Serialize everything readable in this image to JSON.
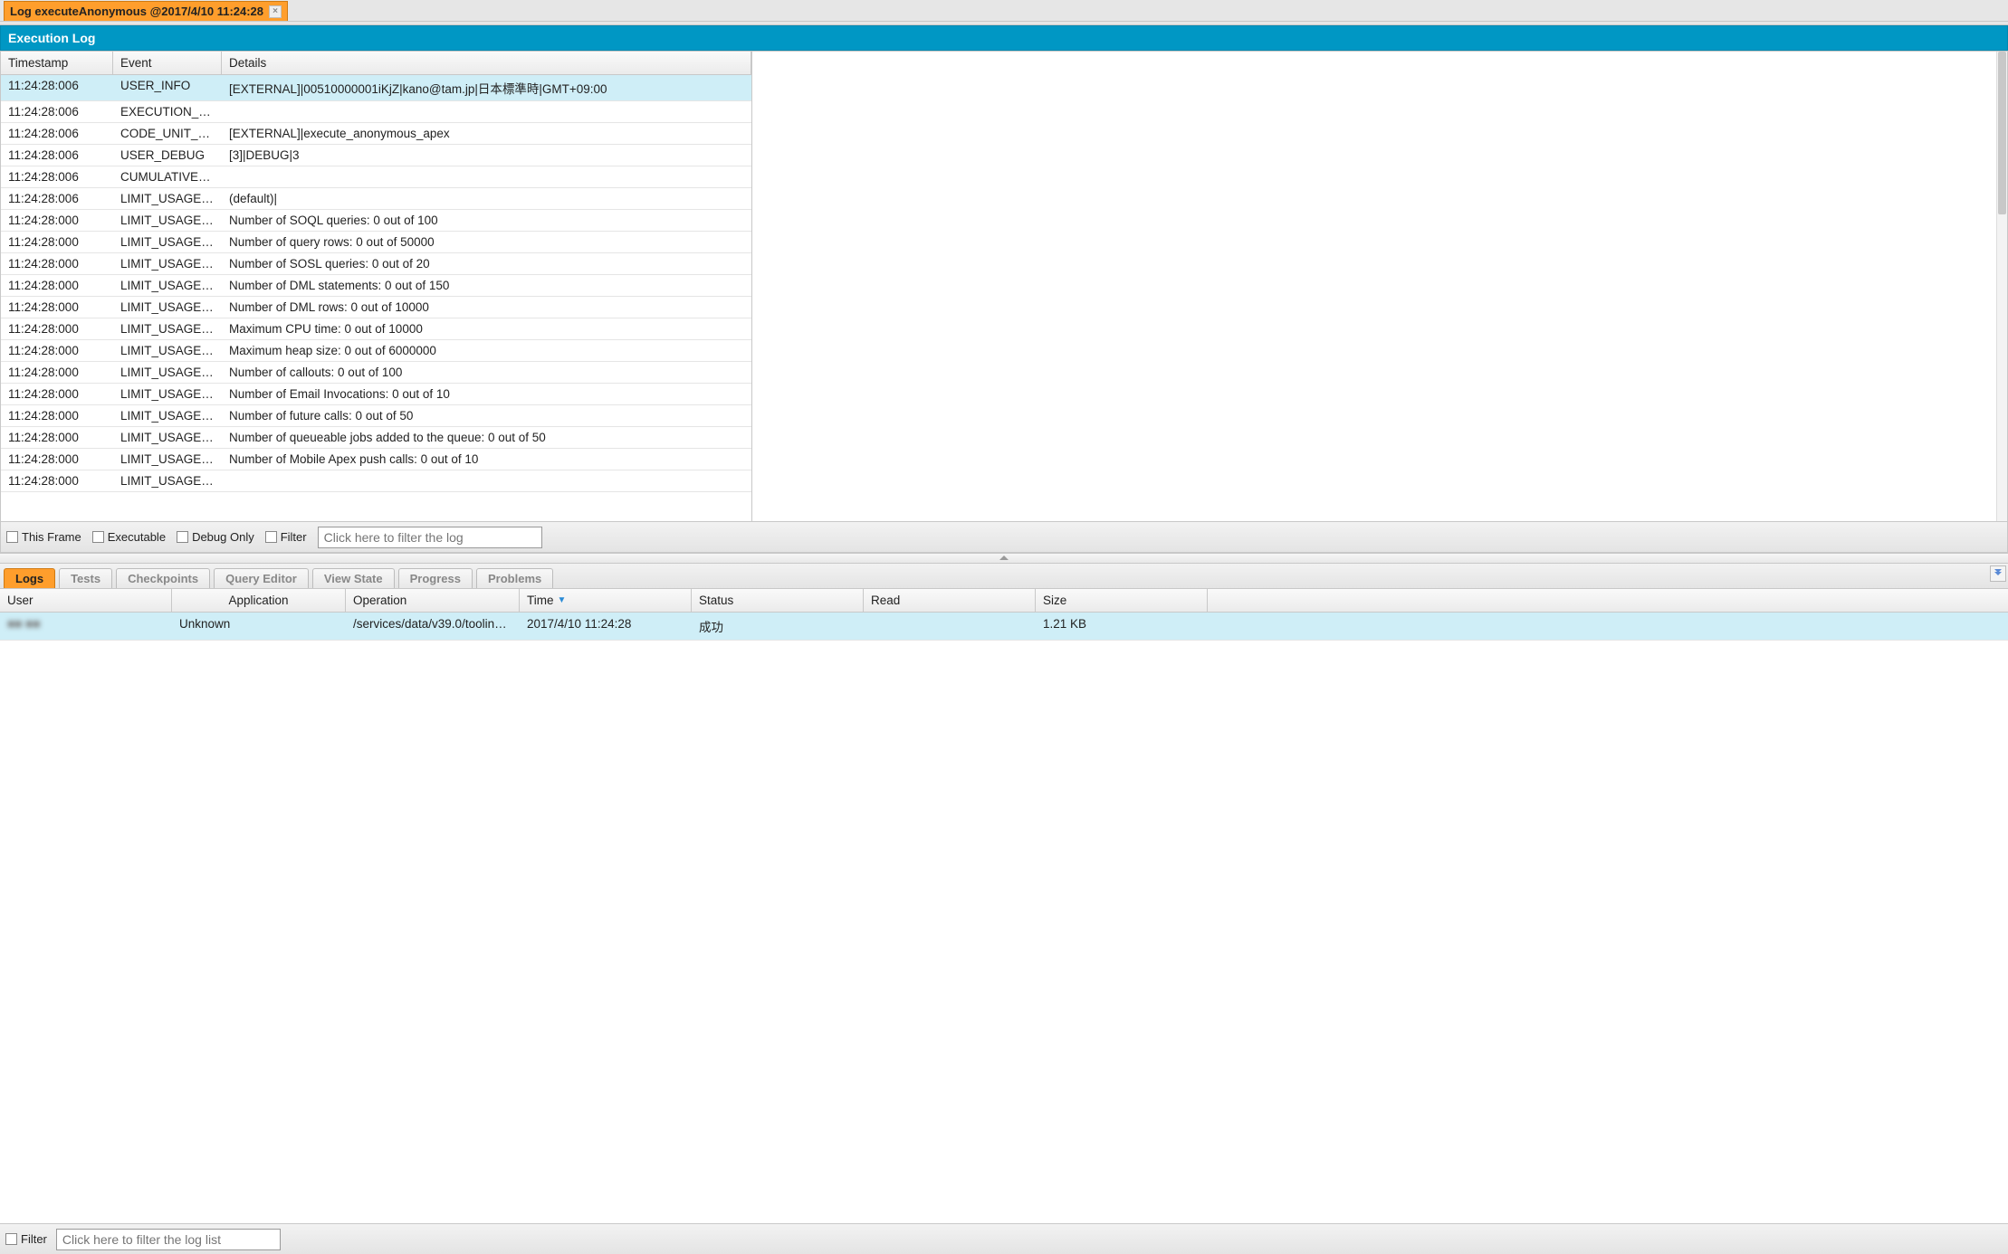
{
  "top_tab": {
    "label": "Log executeAnonymous @2017/4/10 11:24:28"
  },
  "section_title": "Execution Log",
  "log_columns": {
    "timestamp": "Timestamp",
    "event": "Event",
    "details": "Details"
  },
  "log_rows": [
    {
      "ts": "11:24:28:006",
      "ev": "USER_INFO",
      "de": "[EXTERNAL]|00510000001iKjZ|kano@tam.jp|日本標準時|GMT+09:00",
      "sel": true
    },
    {
      "ts": "11:24:28:006",
      "ev": "EXECUTION_S…",
      "de": ""
    },
    {
      "ts": "11:24:28:006",
      "ev": "CODE_UNIT_S…",
      "de": "[EXTERNAL]|execute_anonymous_apex"
    },
    {
      "ts": "11:24:28:006",
      "ev": "USER_DEBUG",
      "de": "[3]|DEBUG|3"
    },
    {
      "ts": "11:24:28:006",
      "ev": "CUMULATIVE_…",
      "de": ""
    },
    {
      "ts": "11:24:28:006",
      "ev": "LIMIT_USAGE_…",
      "de": "(default)|"
    },
    {
      "ts": "11:24:28:000",
      "ev": "LIMIT_USAGE_…",
      "de": "Number of SOQL queries: 0 out of 100"
    },
    {
      "ts": "11:24:28:000",
      "ev": "LIMIT_USAGE_…",
      "de": "Number of query rows: 0 out of 50000"
    },
    {
      "ts": "11:24:28:000",
      "ev": "LIMIT_USAGE_…",
      "de": "Number of SOSL queries: 0 out of 20"
    },
    {
      "ts": "11:24:28:000",
      "ev": "LIMIT_USAGE_…",
      "de": "Number of DML statements: 0 out of 150"
    },
    {
      "ts": "11:24:28:000",
      "ev": "LIMIT_USAGE_…",
      "de": "Number of DML rows: 0 out of 10000"
    },
    {
      "ts": "11:24:28:000",
      "ev": "LIMIT_USAGE_…",
      "de": "Maximum CPU time: 0 out of 10000"
    },
    {
      "ts": "11:24:28:000",
      "ev": "LIMIT_USAGE_…",
      "de": "Maximum heap size: 0 out of 6000000"
    },
    {
      "ts": "11:24:28:000",
      "ev": "LIMIT_USAGE_…",
      "de": "Number of callouts: 0 out of 100"
    },
    {
      "ts": "11:24:28:000",
      "ev": "LIMIT_USAGE_…",
      "de": "Number of Email Invocations: 0 out of 10"
    },
    {
      "ts": "11:24:28:000",
      "ev": "LIMIT_USAGE_…",
      "de": "Number of future calls: 0 out of 50"
    },
    {
      "ts": "11:24:28:000",
      "ev": "LIMIT_USAGE_…",
      "de": "Number of queueable jobs added to the queue: 0 out of 50"
    },
    {
      "ts": "11:24:28:000",
      "ev": "LIMIT_USAGE_…",
      "de": "Number of Mobile Apex push calls: 0 out of 10"
    },
    {
      "ts": "11:24:28:000",
      "ev": "LIMIT_USAGE_…",
      "de": ""
    }
  ],
  "log_filter": {
    "this_frame": "This Frame",
    "executable": "Executable",
    "debug_only": "Debug Only",
    "filter": "Filter",
    "placeholder": "Click here to filter the log"
  },
  "bottom_tabs": {
    "logs": "Logs",
    "tests": "Tests",
    "checkpoints": "Checkpoints",
    "query_editor": "Query Editor",
    "view_state": "View State",
    "progress": "Progress",
    "problems": "Problems"
  },
  "logs_columns": {
    "user": "User",
    "application": "Application",
    "operation": "Operation",
    "time": "Time",
    "status": "Status",
    "read": "Read",
    "size": "Size"
  },
  "logs_rows": [
    {
      "user": "■■ ■■",
      "application": "Unknown",
      "operation": "/services/data/v39.0/tooling…",
      "time": "2017/4/10 11:24:28",
      "status": "成功",
      "read": "",
      "size": "1.21 KB",
      "sel": true
    }
  ],
  "bottom_filter": {
    "filter": "Filter",
    "placeholder": "Click here to filter the log list"
  }
}
